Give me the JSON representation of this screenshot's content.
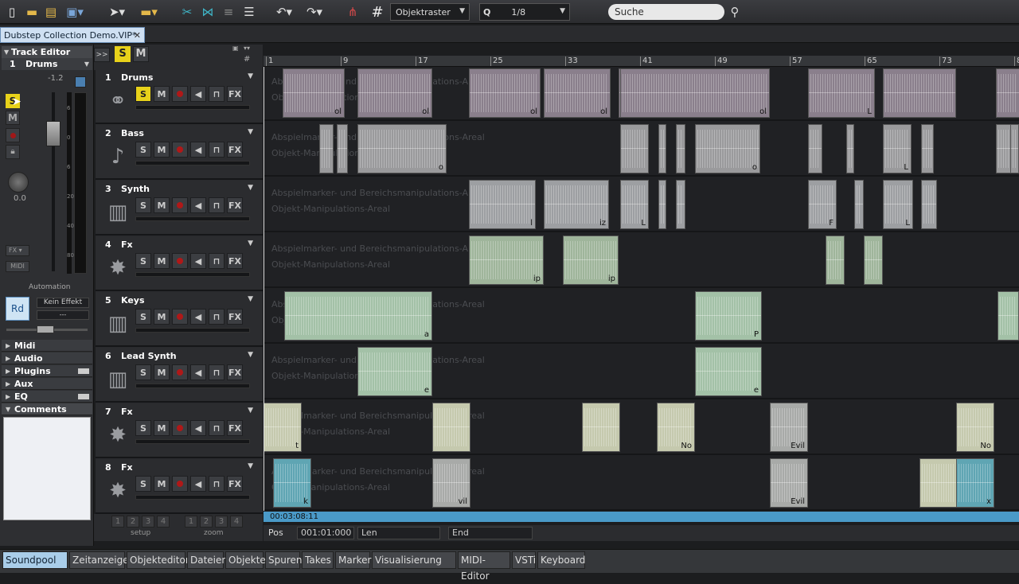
{
  "toolbar": {
    "raster": "Objektraster",
    "quantize": "1/8",
    "search_placeholder": "Suche"
  },
  "document_tab": "Dubstep Collection Demo.VIP*",
  "track_editor": {
    "title": "Track Editor",
    "track_num": "1",
    "track_name": "Drums",
    "volume": "-1.2",
    "pan": "0.0",
    "fader_scale": [
      "6",
      "0",
      "6",
      "20",
      "40",
      "80"
    ],
    "fx_label": "FX",
    "midi_label": "MIDI",
    "automation_label": "Automation",
    "rd_label": "Rd",
    "effect_label": "Kein Effekt",
    "effect_value": "---",
    "s_label": "S",
    "m_label": "M",
    "sections": [
      "Midi",
      "Audio",
      "Plugins",
      "Aux",
      "EQ",
      "Comments"
    ]
  },
  "global": {
    "solo": "S",
    "mute": "M",
    "collapse": ">>"
  },
  "button_labels": {
    "s": "S",
    "m": "M",
    "fx": "FX"
  },
  "tracks": [
    {
      "num": "1",
      "name": "Drums",
      "icon": "drums-icon",
      "solo_on": true
    },
    {
      "num": "2",
      "name": "Bass",
      "icon": "guitar-icon",
      "solo_on": false
    },
    {
      "num": "3",
      "name": "Synth",
      "icon": "keyboard-icon",
      "solo_on": false
    },
    {
      "num": "4",
      "name": "Fx",
      "icon": "fx-burst-icon",
      "solo_on": false
    },
    {
      "num": "5",
      "name": "Keys",
      "icon": "keyboard-icon",
      "solo_on": false
    },
    {
      "num": "6",
      "name": "Lead Synth",
      "icon": "keyboard-icon",
      "solo_on": false
    },
    {
      "num": "7",
      "name": "Fx",
      "icon": "fx-burst-icon",
      "solo_on": false
    },
    {
      "num": "8",
      "name": "Fx",
      "icon": "fx-burst-icon",
      "solo_on": false
    }
  ],
  "ruler": [
    "1",
    "9",
    "17",
    "25",
    "33",
    "41",
    "49",
    "57",
    "65",
    "73",
    "8"
  ],
  "hints": {
    "play": "Abspielmarker- und Bereichsmanipulations-Areal",
    "object": "Objekt-Manipulations-Areal"
  },
  "clip_labels": [
    "ol",
    "ol",
    "ol",
    "ol",
    "ol",
    "L",
    "L",
    "o",
    "o",
    "o",
    "l",
    "F",
    "iz",
    "L",
    "L",
    "ip",
    "ip",
    "ip",
    "l",
    "a",
    "a",
    "a",
    "a",
    "P",
    "e",
    "e",
    "e",
    "t",
    "No",
    "Evil",
    "No",
    "k",
    "vil",
    "Evil",
    "x"
  ],
  "colors": {
    "drums": "#8a7f8c",
    "bass": "#9a9a9c",
    "synth": "#9d9fa2",
    "fx": "#9fb59b",
    "keys": "#a3c1a7",
    "lead": "#a3c1a7",
    "fx7": "#c5c9ae",
    "fx7b": "#a8aaa8",
    "fx8": "#5fa5b3"
  },
  "position": {
    "selection_time": "00:03:08:11",
    "pos_label": "Pos",
    "pos_value": "001:01:000",
    "len_label": "Len",
    "end_label": "End"
  },
  "setup_label": "setup",
  "zoom_label": "zoom",
  "setup_buttons": [
    "1",
    "2",
    "3",
    "4"
  ],
  "zoom_buttons": [
    "1",
    "2",
    "3",
    "4"
  ],
  "bottom_tabs": [
    "Soundpool",
    "Zeitanzeige",
    "Objekteditor",
    "Dateien",
    "Objekte",
    "Spuren",
    "Takes",
    "Marker",
    "Visualisierung",
    "MIDI-Editor",
    "VSTi",
    "Keyboard"
  ],
  "active_bottom_tab": "Soundpool"
}
